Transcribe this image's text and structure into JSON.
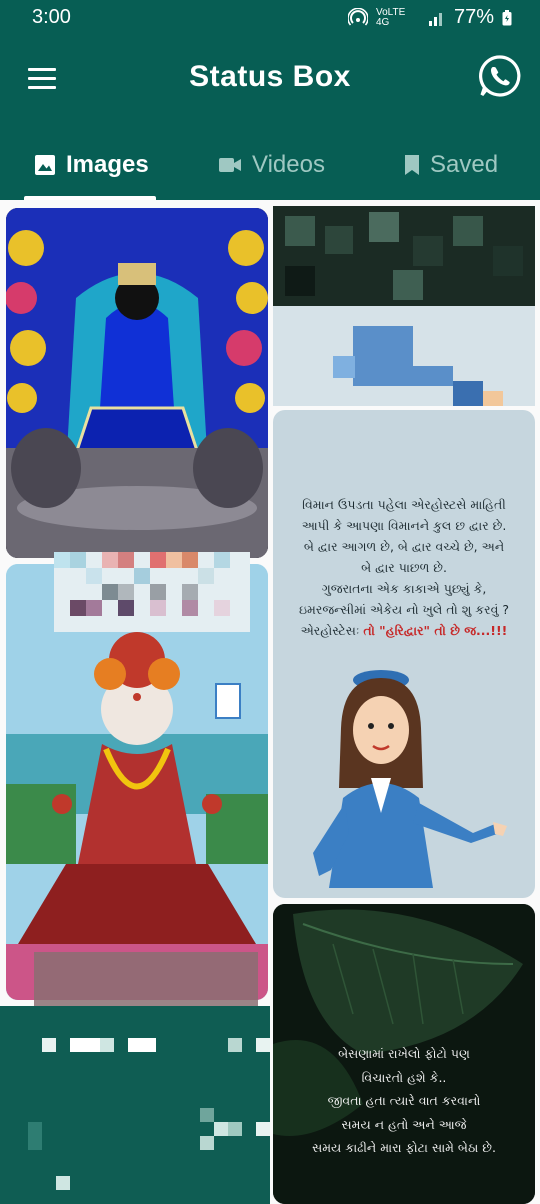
{
  "status_bar": {
    "time": "3:00",
    "network": "VoLTE 4G",
    "battery": "77%"
  },
  "app_bar": {
    "title": "Status Box"
  },
  "tabs": [
    {
      "label": "Images",
      "icon": "image-icon",
      "active": true
    },
    {
      "label": "Videos",
      "icon": "video-icon",
      "active": false
    },
    {
      "label": "Saved",
      "icon": "bookmark-icon",
      "active": false
    }
  ],
  "colors": {
    "primary": "#075e54",
    "tab_inactive": "#9fc8c2",
    "accent_red": "#c62828"
  },
  "cards": {
    "joke": {
      "line1": "વિમાન ઉપડતા પહેલા એરહોસ્ટસે માહિતી",
      "line2": "આપી કે આપણા વિમાનને કુલ છ દ્વાર છે.",
      "line3": "બે દ્વાર આગળ છે, બે દ્વાર વચ્ચે છે, અને",
      "line4": "બે દ્વાર પાછળ છે.",
      "line5": "ગુજરાતના એક કાકાએ પુછ્યું કે,",
      "line6": "ઇમરજન્સીમાં એકેય નો ખુલે તો શુ કરવું ?",
      "line7_prefix": "એરહોસ્ટેસઃ ",
      "line7_highlight": "તો \"હરિદ્વાર\" તો છે જ...!!!"
    },
    "quote": {
      "line1": "બેસણામાં રાખેલો ફોટો પણ",
      "line2": "વિચારતો હશે કે..",
      "line3": "જીવતા હતા ત્યારે વાત કરવાનો",
      "line4": "સમય ન હતો અને આજે",
      "line5": "સમય કાઢીને મારા ફોટા સામે બેઠા છે."
    }
  }
}
